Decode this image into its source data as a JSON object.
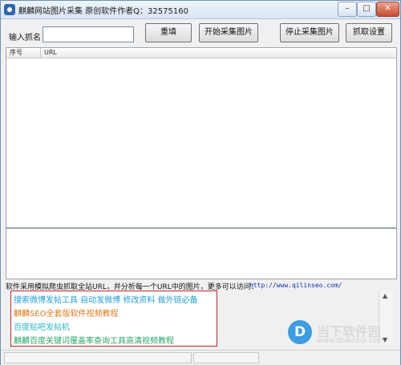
{
  "window": {
    "title": "麒麟网站图片采集 原创软件作者Q：32575160",
    "controls": {
      "minimize": "–",
      "maximize": "□",
      "close": "✕"
    }
  },
  "toolbar": {
    "keyword_label": "输入抓名",
    "keyword_value": "",
    "reset_label": "重填",
    "start_label": "开始采集图片",
    "stop_label": "停止采集图片",
    "settings_label": "抓取设置"
  },
  "table": {
    "columns": [
      "序号",
      "URL"
    ],
    "rows": []
  },
  "description": {
    "text": "软件采用模拟爬虫抓取全站URL，并分析每一个URL中的图片，更多可以访问：",
    "link": "http://www.qilinseo.com/"
  },
  "ads": [
    "搜索微博发帖工具  自动发微博  修改资料  做外链必备",
    "麒麟SEO全套版软件视频教程",
    "百度贴吧发帖机",
    "麒麟百度关键词覆盖率查询工具高清视频教程"
  ],
  "watermark": {
    "icon": "D",
    "text": "当下软件园",
    "url": "www.downxia.com"
  },
  "colors": {
    "ad_border": "#c0282b",
    "link": "#0a2fb5",
    "title_bar": "#d8e5f3"
  }
}
